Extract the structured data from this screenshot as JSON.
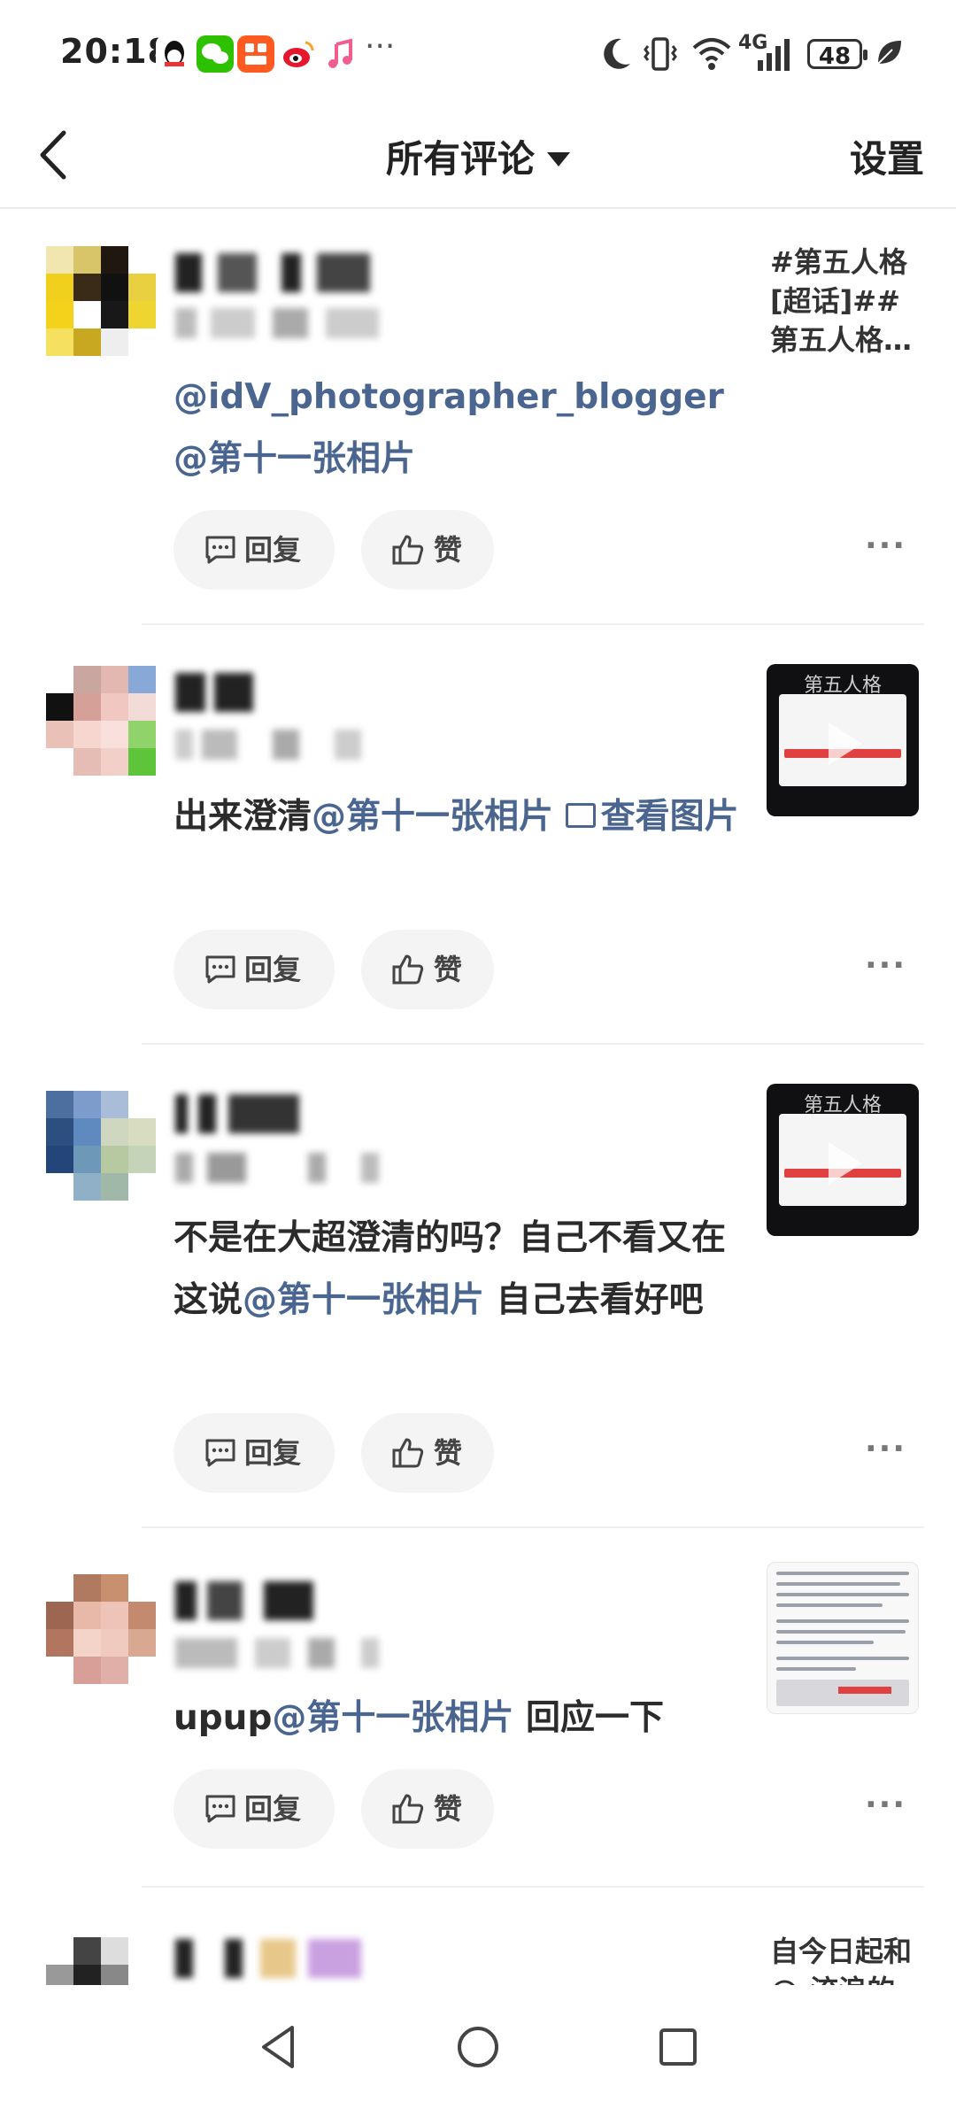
{
  "status_bar": {
    "time": "20:18",
    "network": "4G",
    "battery": "48",
    "notification_icons": [
      "qq-icon",
      "wechat-icon",
      "taobao-icon",
      "weibo-icon",
      "music-icon"
    ],
    "overflow": "···"
  },
  "header": {
    "title": "所有评论",
    "settings_label": "设置"
  },
  "colors": {
    "mention": "#4a6690",
    "text": "#2b2b2b",
    "button_bg": "#f4f4f4"
  },
  "actions": {
    "reply_label": "回复",
    "like_label": "赞",
    "more": "···"
  },
  "comments": [
    {
      "text_segments": [
        {
          "t": "@idV_photographer_blogger @",
          "mention": true
        },
        {
          "t": "第十一张相片",
          "mention": true
        }
      ],
      "side_text": "#第五人格[超话]##第五人格…"
    },
    {
      "text_segments": [
        {
          "t": "出来澄清",
          "mention": false
        },
        {
          "t": "@第十一张相片",
          "mention": true
        }
      ],
      "image_link": "查看图片",
      "thumbnail": "video-thumbnail",
      "thumbnail_logo": "第五人格"
    },
    {
      "text_segments": [
        {
          "t": "不是在大超澄清的吗？自己不看又在这说",
          "mention": false
        },
        {
          "t": "@第十一张相片",
          "mention": true
        },
        {
          "t": " 自己去看好吧",
          "mention": false
        }
      ],
      "thumbnail": "video-thumbnail",
      "thumbnail_logo": "第五人格"
    },
    {
      "text_segments": [
        {
          "t": "upup",
          "mention": false
        },
        {
          "t": "@第十一张相片",
          "mention": true
        },
        {
          "t": " 回应一下",
          "mention": false
        }
      ],
      "thumbnail": "document-thumbnail"
    },
    {
      "text_segments": [],
      "side_text": "自今日起和@-流浪的"
    }
  ]
}
